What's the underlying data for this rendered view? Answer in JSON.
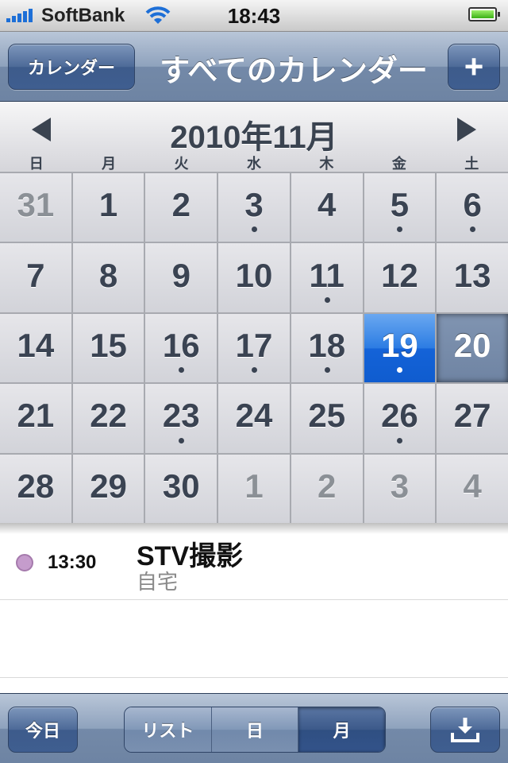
{
  "status_bar": {
    "carrier": "SoftBank",
    "time": "18:43",
    "signal_bars": 5,
    "battery_level": 1.0
  },
  "nav": {
    "back_label": "カレンダー",
    "title": "すべてのカレンダー",
    "add_label": "+"
  },
  "calendar": {
    "month_title": "2010年11月",
    "weekdays": [
      "日",
      "月",
      "火",
      "水",
      "木",
      "金",
      "土"
    ],
    "days": [
      {
        "label": "31",
        "other": true,
        "dot": false
      },
      {
        "label": "1",
        "other": false,
        "dot": false
      },
      {
        "label": "2",
        "other": false,
        "dot": false
      },
      {
        "label": "3",
        "other": false,
        "dot": true
      },
      {
        "label": "4",
        "other": false,
        "dot": false
      },
      {
        "label": "5",
        "other": false,
        "dot": true
      },
      {
        "label": "6",
        "other": false,
        "dot": true
      },
      {
        "label": "7",
        "other": false,
        "dot": false
      },
      {
        "label": "8",
        "other": false,
        "dot": false
      },
      {
        "label": "9",
        "other": false,
        "dot": false
      },
      {
        "label": "10",
        "other": false,
        "dot": false
      },
      {
        "label": "11",
        "other": false,
        "dot": true
      },
      {
        "label": "12",
        "other": false,
        "dot": false
      },
      {
        "label": "13",
        "other": false,
        "dot": false
      },
      {
        "label": "14",
        "other": false,
        "dot": false
      },
      {
        "label": "15",
        "other": false,
        "dot": false
      },
      {
        "label": "16",
        "other": false,
        "dot": true
      },
      {
        "label": "17",
        "other": false,
        "dot": true
      },
      {
        "label": "18",
        "other": false,
        "dot": true
      },
      {
        "label": "19",
        "other": false,
        "dot": true,
        "state": "selected"
      },
      {
        "label": "20",
        "other": false,
        "dot": false,
        "state": "today"
      },
      {
        "label": "21",
        "other": false,
        "dot": false
      },
      {
        "label": "22",
        "other": false,
        "dot": false
      },
      {
        "label": "23",
        "other": false,
        "dot": true
      },
      {
        "label": "24",
        "other": false,
        "dot": false
      },
      {
        "label": "25",
        "other": false,
        "dot": false
      },
      {
        "label": "26",
        "other": false,
        "dot": true
      },
      {
        "label": "27",
        "other": false,
        "dot": false
      },
      {
        "label": "28",
        "other": false,
        "dot": false
      },
      {
        "label": "29",
        "other": false,
        "dot": false
      },
      {
        "label": "30",
        "other": false,
        "dot": false
      },
      {
        "label": "1",
        "other": true,
        "dot": false
      },
      {
        "label": "2",
        "other": true,
        "dot": false
      },
      {
        "label": "3",
        "other": true,
        "dot": false
      },
      {
        "label": "4",
        "other": true,
        "dot": false
      }
    ]
  },
  "events": [
    {
      "time": "13:30",
      "title": "STV撮影",
      "location": "自宅",
      "color": "#c59ccc"
    }
  ],
  "toolbar": {
    "today_label": "今日",
    "segments": [
      "リスト",
      "日",
      "月"
    ],
    "active_segment": "月",
    "download_icon": "download-tray-icon"
  },
  "colors": {
    "selected_day": "#1463d8",
    "navbar": "#7389a8"
  }
}
